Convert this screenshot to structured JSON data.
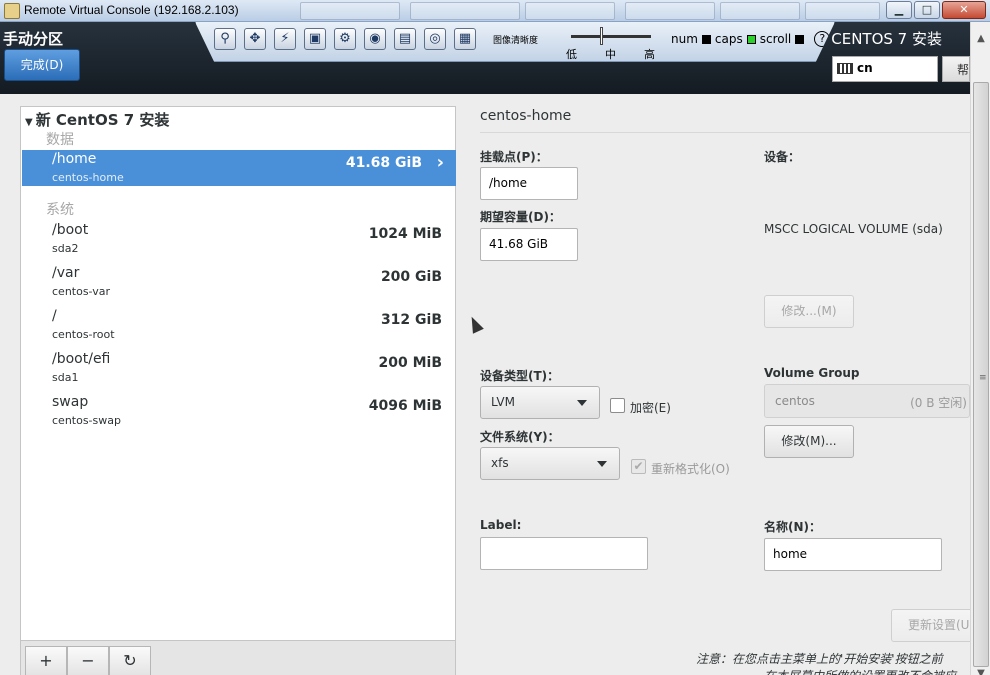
{
  "window": {
    "title": "Remote Virtual Console (192.168.2.103)",
    "min_label": "▁",
    "max_label": "□",
    "close_label": "✕"
  },
  "header": {
    "title": "手动分区",
    "done_button": "完成(D)",
    "product": "CENTOS 7 安装",
    "keyboard_layout": "cn",
    "help_button": "帮"
  },
  "kvm_toolbar": {
    "icons": [
      "pin-icon",
      "fit-icon",
      "macro-icon",
      "screen-icon",
      "settings-icon",
      "disk-icon",
      "floppy-icon",
      "cd-icon",
      "dvd-icon"
    ],
    "quality_label": "图像清晰度",
    "low": "低",
    "mid": "中",
    "high": "高",
    "num": "num",
    "caps": "caps",
    "scroll": "scroll",
    "help": "?",
    "led_colors": {
      "num": "#000000",
      "caps": "#2bd02b",
      "scroll": "#000000"
    }
  },
  "left_panel": {
    "install_title": "新 CentOS 7 安装",
    "sections": [
      {
        "label": "数据",
        "items": [
          {
            "mount": "/home",
            "device": "centos-home",
            "size": "41.68 GiB",
            "selected": true
          }
        ]
      },
      {
        "label": "系统",
        "items": [
          {
            "mount": "/boot",
            "device": "sda2",
            "size": "1024 MiB"
          },
          {
            "mount": "/var",
            "device": "centos-var",
            "size": "200 GiB"
          },
          {
            "mount": "/",
            "device": "centos-root",
            "size": "312 GiB"
          },
          {
            "mount": "/boot/efi",
            "device": "sda1",
            "size": "200 MiB"
          },
          {
            "mount": "swap",
            "device": "centos-swap",
            "size": "4096 MiB"
          }
        ]
      }
    ],
    "toolbar": {
      "add": "+",
      "remove": "−",
      "refresh": "↻"
    }
  },
  "right_panel": {
    "title": "centos-home",
    "mount_point_label": "挂载点(P)：",
    "mount_point_value": "/home",
    "capacity_label": "期望容量(D)：",
    "capacity_value": "41.68 GiB",
    "device_label": "设备：",
    "device_value": "MSCC LOGICAL VOLUME (sda)",
    "modify_button": "修改...(M)",
    "device_type_label": "设备类型(T)：",
    "device_type_value": "LVM",
    "encrypt_label": "加密(E)",
    "filesystem_label": "文件系统(Y)：",
    "filesystem_value": "xfs",
    "reformat_label": "重新格式化(O)",
    "volume_group_label": "Volume Group",
    "volume_group_value": "centos",
    "volume_group_free": "(0 B 空闲)",
    "vg_modify_button": "修改(M)...",
    "label_label": "Label:",
    "label_value": "",
    "name_label": "名称(N)：",
    "name_value": "home",
    "update_button": "更新设置(U",
    "note_line1": "注意：在您点击主菜单上的'开始安装'按钮之前",
    "note_line2": "在本屏幕中所做的设置更改不会被应"
  }
}
